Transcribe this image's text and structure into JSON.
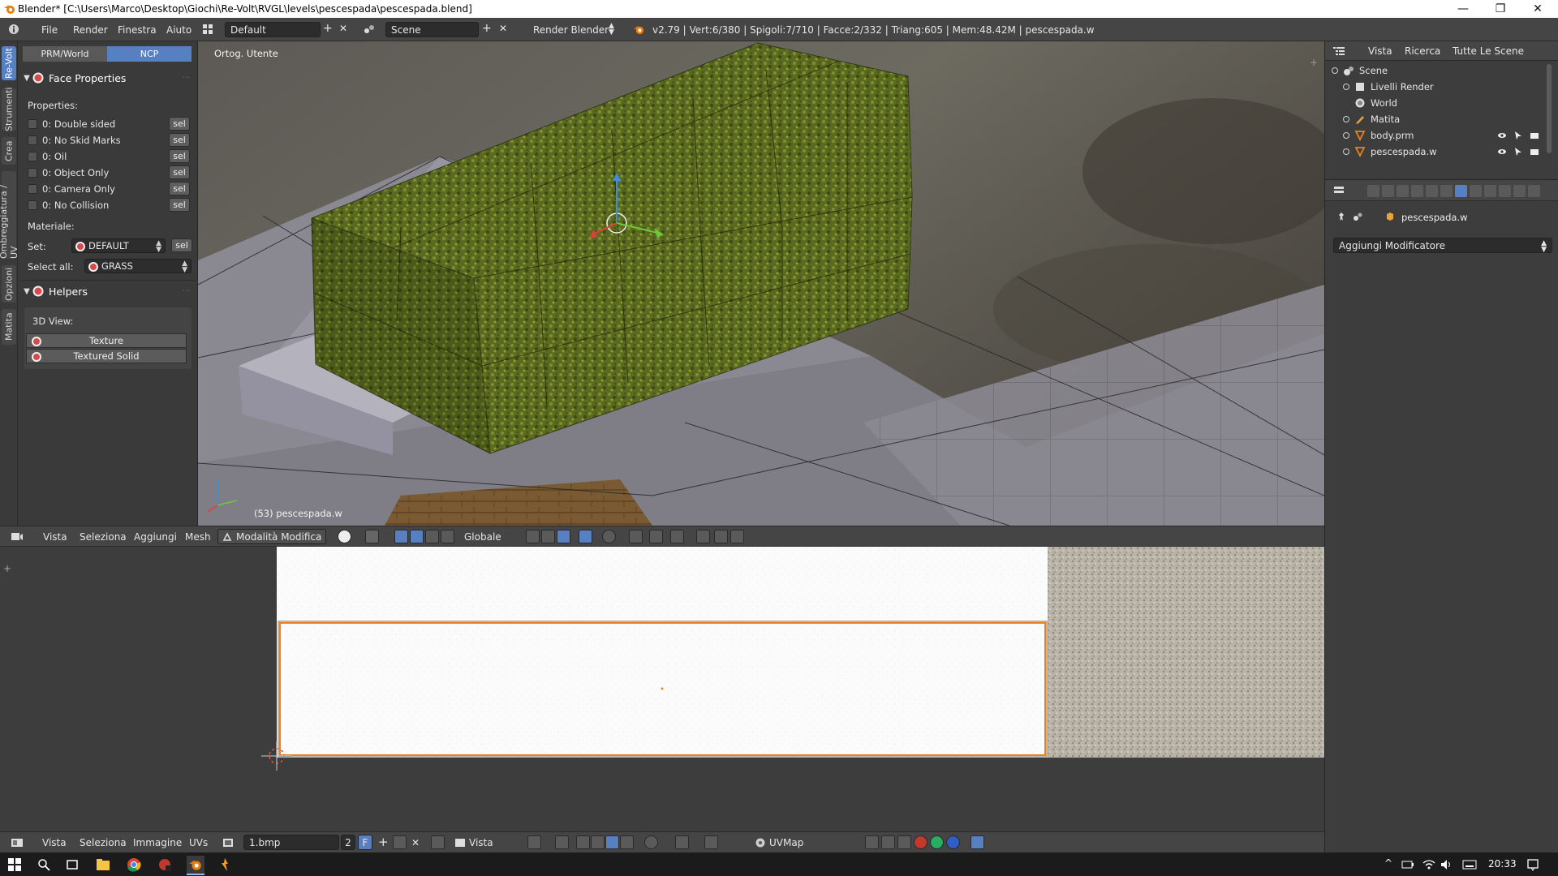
{
  "titlebar": {
    "title": "Blender* [C:\\Users\\Marco\\Desktop\\Giochi\\Re-Volt\\RVGL\\levels\\pescespada\\pescespada.blend]"
  },
  "infobar": {
    "menus": [
      "File",
      "Render",
      "Finestra",
      "Aiuto"
    ],
    "layout": "Default",
    "scene": "Scene",
    "engine": "Render Blender",
    "stats": "v2.79 | Vert:6/380 | Spigoli:7/710 | Facce:2/332 | Triang:605 | Mem:48.42M | pescespada.w"
  },
  "left_tabs": [
    "Re-Volt",
    "Strumenti",
    "Crea",
    "Ombreggiatura / UV",
    "Opzioni",
    "Matita"
  ],
  "toolshelf": {
    "mode_tabs": [
      "PRM/World",
      "NCP"
    ],
    "face_properties": {
      "title": "Face Properties",
      "properties_label": "Properties:",
      "items": [
        "0: Double sided",
        "0: No Skid Marks",
        "0: Oil",
        "0: Object Only",
        "0: Camera Only",
        "0: No Collision"
      ],
      "sel_label": "sel",
      "material_label": "Materiale:",
      "set_label": "Set:",
      "set_value": "DEFAULT",
      "select_all_label": "Select all:",
      "select_all_value": "GRASS"
    },
    "helpers": {
      "title": "Helpers",
      "view_label": "3D View:",
      "buttons": [
        "Texture",
        "Textured Solid"
      ]
    }
  },
  "viewport": {
    "view_name": "Ortog. Utente",
    "object_label": "(53) pescespada.w"
  },
  "view3d_header": {
    "menus": [
      "Vista",
      "Seleziona",
      "Aggiungi",
      "Mesh"
    ],
    "mode": "Modalità Modifica",
    "orientation": "Globale"
  },
  "uv_header": {
    "menus": [
      "Vista",
      "Seleziona",
      "Immagine",
      "UVs"
    ],
    "image": "1.bmp",
    "users": "2",
    "fake_user": "F",
    "view": "Vista",
    "uvmap": "UVMap"
  },
  "outliner": {
    "menus": [
      "Vista",
      "Ricerca"
    ],
    "filter": "Tutte Le Scene",
    "items": [
      "Scene",
      "Livelli Render",
      "World",
      "Matita",
      "body.prm",
      "pescespada.w"
    ]
  },
  "properties": {
    "object": "pescespada.w",
    "add_modifier": "Aggiungi Modificatore"
  },
  "taskbar": {
    "time": "20:33"
  },
  "colors": {
    "accent": "#5680c2",
    "panel": "#3a3a3a",
    "header": "#454545",
    "grass": "#5a6b1f"
  }
}
